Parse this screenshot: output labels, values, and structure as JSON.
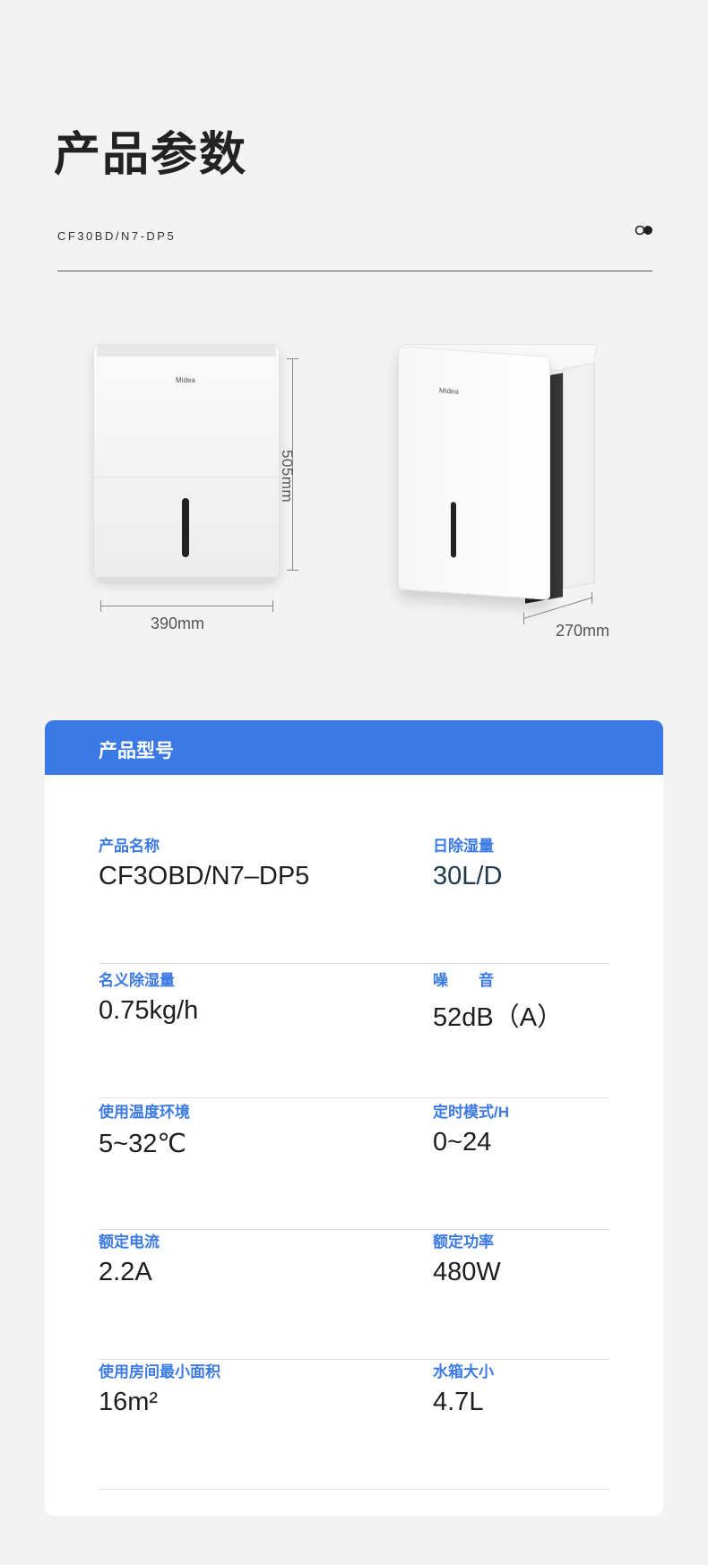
{
  "page": {
    "title": "产品参数",
    "model_code": "CF30BD/N7-DP5"
  },
  "product_images": {
    "brand_logo": "Midea",
    "front_height": "505mm",
    "front_width": "390mm",
    "side_depth": "270mm"
  },
  "specs": {
    "header": "产品型号",
    "rows": [
      {
        "left": {
          "label": "产品名称",
          "value": "CF3OBD/N7–DP5"
        },
        "right": {
          "label": "日除湿量",
          "value": "30L/D"
        }
      },
      {
        "left": {
          "label": "名义除湿量",
          "value": "0.75kg/h"
        },
        "right": {
          "label": "噪　　音",
          "value": "52dB（A）"
        }
      },
      {
        "left": {
          "label": "使用温度环境",
          "value": "5~32℃"
        },
        "right": {
          "label": "定时模式/H",
          "value": "0~24"
        }
      },
      {
        "left": {
          "label": "额定电流",
          "value": "2.2A"
        },
        "right": {
          "label": "额定功率",
          "value": "480W"
        }
      },
      {
        "left": {
          "label": "使用房间最小面积",
          "value": "16m²"
        },
        "right": {
          "label": "水箱大小",
          "value": "4.7L"
        }
      }
    ]
  },
  "colors": {
    "accent": "#3b7ae5",
    "background": "#f3f3f3"
  }
}
